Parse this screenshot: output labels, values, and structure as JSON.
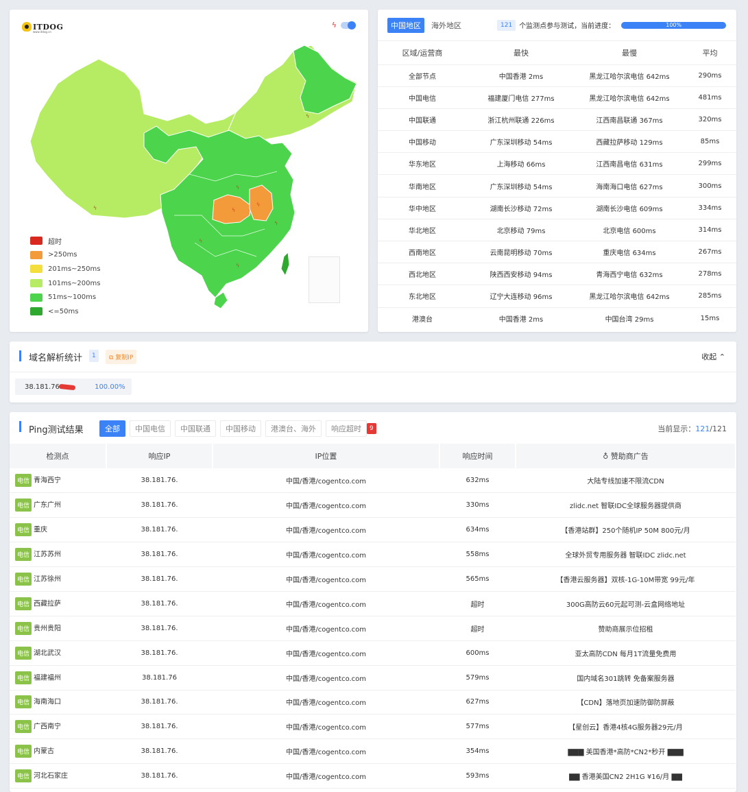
{
  "map": {
    "logo_text": "ITDOG",
    "logo_sub": "www.itdog.cn",
    "legend": [
      {
        "label": "超时",
        "color": "#d9281e"
      },
      {
        "label": ">250ms",
        "color": "#f39a3b"
      },
      {
        "label": "201ms~250ms",
        "color": "#f3de3b"
      },
      {
        "label": "101ms~200ms",
        "color": "#b6ec63"
      },
      {
        "label": "51ms~100ms",
        "color": "#4cd44c"
      },
      {
        "label": "<=50ms",
        "color": "#2ea82e"
      }
    ]
  },
  "stats": {
    "tabs": [
      "中国地区",
      "海外地区"
    ],
    "monitor_count": "121",
    "monitor_text": "个监测点参与测试，当前进度：",
    "progress": 100,
    "progress_label": "100%",
    "headers": [
      "区域/运营商",
      "最快",
      "最慢",
      "平均"
    ],
    "rows": [
      {
        "region": "全部节点",
        "fastest": "中国香港 2ms",
        "slowest": "黑龙江哈尔滨电信 642ms",
        "avg": "290ms"
      },
      {
        "region": "中国电信",
        "fastest": "福建厦门电信 277ms",
        "slowest": "黑龙江哈尔滨电信 642ms",
        "avg": "481ms"
      },
      {
        "region": "中国联通",
        "fastest": "浙江杭州联通 226ms",
        "slowest": "江西南昌联通 367ms",
        "avg": "320ms"
      },
      {
        "region": "中国移动",
        "fastest": "广东深圳移动 54ms",
        "slowest": "西藏拉萨移动 129ms",
        "avg": "85ms"
      },
      {
        "region": "华东地区",
        "fastest": "上海移动 66ms",
        "slowest": "江西南昌电信 631ms",
        "avg": "299ms"
      },
      {
        "region": "华南地区",
        "fastest": "广东深圳移动 54ms",
        "slowest": "海南海口电信 627ms",
        "avg": "300ms"
      },
      {
        "region": "华中地区",
        "fastest": "湖南长沙移动 72ms",
        "slowest": "湖南长沙电信 609ms",
        "avg": "334ms"
      },
      {
        "region": "华北地区",
        "fastest": "北京移动 79ms",
        "slowest": "北京电信 600ms",
        "avg": "314ms"
      },
      {
        "region": "西南地区",
        "fastest": "云南昆明移动 70ms",
        "slowest": "重庆电信 634ms",
        "avg": "267ms"
      },
      {
        "region": "西北地区",
        "fastest": "陕西西安移动 94ms",
        "slowest": "青海西宁电信 632ms",
        "avg": "278ms"
      },
      {
        "region": "东北地区",
        "fastest": "辽宁大连移动 96ms",
        "slowest": "黑龙江哈尔滨电信 642ms",
        "avg": "285ms"
      },
      {
        "region": "港澳台",
        "fastest": "中国香港 2ms",
        "slowest": "中国台湾 29ms",
        "avg": "15ms"
      }
    ]
  },
  "dns": {
    "title": "域名解析统计",
    "count": "1",
    "copy_label": "复制IP",
    "collapse_label": "收起",
    "ip": "38.181.76.",
    "percent": "100.00%"
  },
  "ping": {
    "title": "Ping测试结果",
    "filters": [
      "全部",
      "中国电信",
      "中国联通",
      "中国移动",
      "港澳台、海外",
      "响应超时"
    ],
    "timeout_count": "9",
    "showing_label": "当前显示：",
    "showing_current": "121",
    "showing_total": "/121",
    "headers": [
      "检测点",
      "响应IP",
      "IP位置",
      "响应时间",
      "赞助商广告"
    ],
    "rows": [
      {
        "isp": "电信",
        "node": "青海西宁",
        "ip": "38.181.76.",
        "location": "中国/香港/cogentco.com",
        "time": "632ms",
        "timeout": false,
        "ad": "大陆专线加速不限流CDN",
        "ad_link": false
      },
      {
        "isp": "电信",
        "node": "广东广州",
        "ip": "38.181.76.",
        "location": "中国/香港/cogentco.com",
        "time": "330ms",
        "timeout": false,
        "ad": "zlidc.net 智联IDC全球服务器提供商",
        "ad_link": false
      },
      {
        "isp": "电信",
        "node": "重庆",
        "ip": "38.181.76.",
        "location": "中国/香港/cogentco.com",
        "time": "634ms",
        "timeout": false,
        "ad": "【香港站群】250个随机IP 50M 800元/月",
        "ad_link": false
      },
      {
        "isp": "电信",
        "node": "江苏苏州",
        "ip": "38.181.76.",
        "location": "中国/香港/cogentco.com",
        "time": "558ms",
        "timeout": false,
        "ad": "全球外贸专用服务器 智联IDC zlidc.net",
        "ad_link": false
      },
      {
        "isp": "电信",
        "node": "江苏徐州",
        "ip": "38.181.76.",
        "location": "中国/香港/cogentco.com",
        "time": "565ms",
        "timeout": false,
        "ad": "【香港云服务器】双核-1G-10M带宽 99元/年",
        "ad_link": false
      },
      {
        "isp": "电信",
        "node": "西藏拉萨",
        "ip": "38.181.76.",
        "location": "中国/香港/cogentco.com",
        "time": "超时",
        "timeout": true,
        "ad": "300G高防云60元起可测-云盒网络地址",
        "ad_link": false
      },
      {
        "isp": "电信",
        "node": "贵州贵阳",
        "ip": "38.181.76.",
        "location": "中国/香港/cogentco.com",
        "time": "超时",
        "timeout": true,
        "ad": "赞助商展示位招租",
        "ad_link": true
      },
      {
        "isp": "电信",
        "node": "湖北武汉",
        "ip": "38.181.76.",
        "location": "中国/香港/cogentco.com",
        "time": "600ms",
        "timeout": false,
        "ad": "亚太高防CDN 每月1T流量免费用",
        "ad_link": false
      },
      {
        "isp": "电信",
        "node": "福建福州",
        "ip": "38.181.76",
        "location": "中国/香港/cogentco.com",
        "time": "579ms",
        "timeout": false,
        "ad": "国内域名301跳转 免备案服务器",
        "ad_link": false
      },
      {
        "isp": "电信",
        "node": "海南海口",
        "ip": "38.181.76.",
        "location": "中国/香港/cogentco.com",
        "time": "627ms",
        "timeout": false,
        "ad": "【CDN】落地页加速防御防屏蔽",
        "ad_link": false
      },
      {
        "isp": "电信",
        "node": "广西南宁",
        "ip": "38.181.76.",
        "location": "中国/香港/cogentco.com",
        "time": "577ms",
        "timeout": false,
        "ad": "【星创云】香港4核4G服务器29元/月",
        "ad_link": false
      },
      {
        "isp": "电信",
        "node": "内蒙古",
        "ip": "38.181.76.",
        "location": "中国/香港/cogentco.com",
        "time": "354ms",
        "timeout": false,
        "ad": "▇▇▇ 美国香港*高防*CN2*秒开 ▇▇▇",
        "ad_link": false
      },
      {
        "isp": "电信",
        "node": "河北石家庄",
        "ip": "38.181.76.",
        "location": "中国/香港/cogentco.com",
        "time": "593ms",
        "timeout": false,
        "ad": "▇▇ 香港美国CN2 2H1G ¥16/月 ▇▇",
        "ad_link": false
      }
    ]
  }
}
